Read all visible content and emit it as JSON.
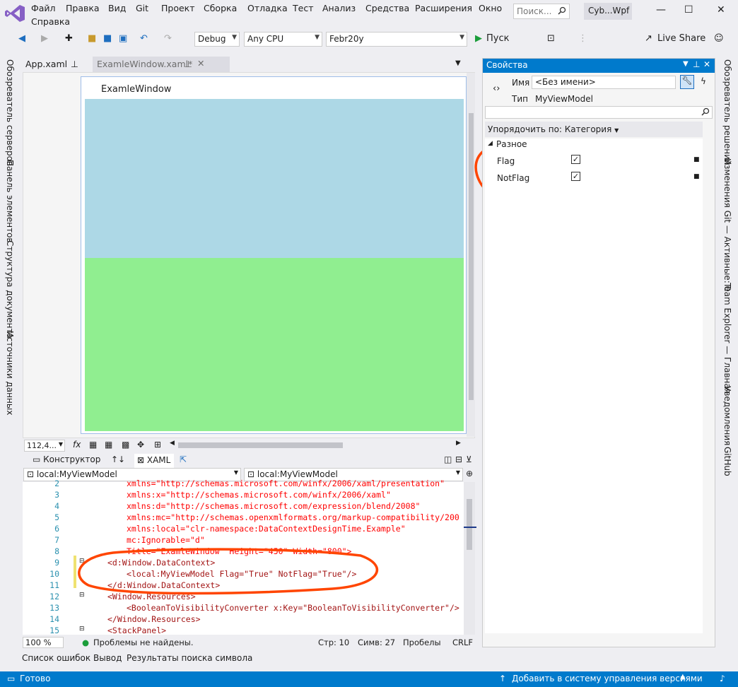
{
  "menu": {
    "items": [
      "Файл",
      "Правка",
      "Вид",
      "Git",
      "Проект",
      "Сборка",
      "Отладка",
      "Тест",
      "Анализ",
      "Средства",
      "Расширения",
      "Окно"
    ],
    "second_row": "Справка",
    "search_placeholder": "Поиск...",
    "solution_name": "Cyb...Wpf"
  },
  "toolbar": {
    "config": "Debug",
    "platform": "Any CPU",
    "project": "Febr20y",
    "run_label": "Пуск",
    "live_share": "Live Share"
  },
  "left_sidebar": [
    "Обозреватель серверов",
    "Панель элементов",
    "Структура документа",
    "Источники данных"
  ],
  "right_sidebar": [
    "Обозреватель решений",
    "Изменения Git — Активные: 0",
    "Team Explorer — Главная",
    "Уведомления",
    "GitHub"
  ],
  "tabs": [
    {
      "label": "App.xaml"
    },
    {
      "label": "ExamleWindow.xaml*"
    }
  ],
  "designer": {
    "window_title": "ExamleWindow",
    "colors": {
      "top": "#add8e6",
      "bottom": "#90ee90"
    },
    "zoom": "112,4...",
    "fx": "fx"
  },
  "split": {
    "designer_tab": "Конструктор",
    "swap_icon": "↑↓",
    "xaml_tab": "XAML"
  },
  "nav": {
    "left": "local:MyViewModel",
    "right": "local:MyViewModel"
  },
  "code": {
    "line_numbers": [
      "2",
      "3",
      "4",
      "5",
      "6",
      "7",
      "8",
      "9",
      "10",
      "11",
      "12",
      "13",
      "14",
      "15"
    ],
    "lines": [
      "xmlns=\"http://schemas.microsoft.com/winfx/2006/xaml/presentation\"",
      "xmlns:x=\"http://schemas.microsoft.com/winfx/2006/xaml\"",
      "xmlns:d=\"http://schemas.microsoft.com/expression/blend/2008\"",
      "xmlns:mc=\"http://schemas.openxmlformats.org/markup-compatibility/200",
      "xmlns:local=\"clr-namespace:DataContextDesignTime.Example\"",
      "mc:Ignorable=\"d\"",
      "Title=\"ExamleWindow\" Height=\"450\" Width=\"800\">",
      "<d:Window.DataContext>",
      "<local:MyViewModel Flag=\"True\" NotFlag=\"True\"/>",
      "</d:Window.DataContext>",
      "<Window.Resources>",
      "<BooleanToVisibilityConverter x:Key=\"BooleanToVisibilityConverter\"/>",
      "</Window.Resources>",
      "<StackPanel>"
    ]
  },
  "editor_status": {
    "zoom": "100 %",
    "problems": "Проблемы не найдены.",
    "line": "Стр: 10",
    "col": "Симв: 27",
    "spaces": "Пробелы",
    "eol": "CRLF"
  },
  "properties": {
    "title": "Свойства",
    "name_label": "Имя",
    "name_value": "<Без имени>",
    "type_label": "Тип",
    "type_value": "MyViewModel",
    "sort_label": "Упорядочить по: Категория",
    "category": "Разное",
    "items": [
      {
        "label": "Flag",
        "checked": true
      },
      {
        "label": "NotFlag",
        "checked": true
      }
    ]
  },
  "bottom_tabs": [
    "Список ошибок",
    "Вывод",
    "Результаты поиска символа"
  ],
  "status": {
    "ready": "Готово",
    "vcs": "Добавить в систему управления версиями"
  },
  "accent": "#007acc",
  "annotation_color": "#ff4500"
}
